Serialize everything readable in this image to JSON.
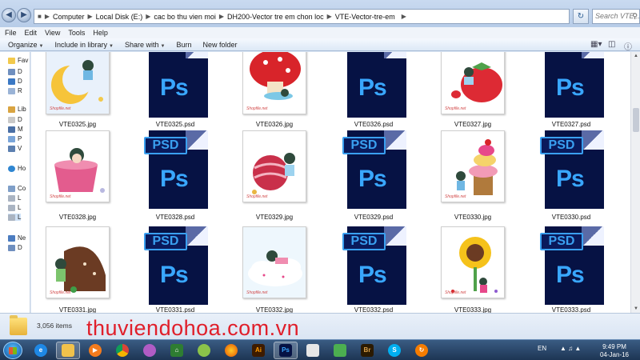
{
  "address": {
    "crumbs": [
      "Computer",
      "Local Disk (E:)",
      "cac bo thu vien moi",
      "DH200-Vector tre em chon loc",
      "VTE-Vector-tre-em"
    ],
    "search_placeholder": "Search VTE..."
  },
  "menu": [
    "File",
    "Edit",
    "View",
    "Tools",
    "Help"
  ],
  "toolbar": {
    "organize": "Organize",
    "include": "Include in library",
    "share": "Share with",
    "burn": "Burn",
    "new_folder": "New folder"
  },
  "navpane": {
    "items": [
      "Fav",
      "D",
      "D",
      "R",
      "Lib",
      "D",
      "M",
      "P",
      "V",
      "Ho",
      "Co",
      "L",
      "L",
      "L",
      "Ne",
      "D"
    ]
  },
  "files": {
    "row1": [
      "VTE0325.jpg",
      "VTE0325.psd",
      "VTE0326.jpg",
      "VTE0326.psd",
      "VTE0327.jpg",
      "VTE0327.psd"
    ],
    "row2": [
      "VTE0328.jpg",
      "VTE0328.psd",
      "VTE0329.jpg",
      "VTE0329.psd",
      "VTE0330.jpg",
      "VTE0330.psd"
    ],
    "row3": [
      "VTE0331.jpg",
      "VTE0331.psd",
      "VTE0332.jpg",
      "VTE0332.psd",
      "VTE0333.jpg",
      "VTE0333.psd"
    ],
    "thumb_watermark": "Shopfile.net",
    "psd_tag": "PSD",
    "psd_mark": "Ps"
  },
  "details": {
    "count": "3,056 items"
  },
  "watermark": "thuviendohoa.com.vn",
  "taskbar": {
    "apps": [
      "ie-icon",
      "explorer-icon",
      "media-icon",
      "chrome-icon",
      "game-icon",
      "vpn-icon",
      "lime-icon",
      "firefox-icon",
      "illustrator-icon",
      "photoshop-icon",
      "notepad-icon",
      "bridge-icon",
      "skype-icon",
      "update-icon"
    ],
    "ai": "Ai",
    "ps": "Ps",
    "br": "Br",
    "language": "EN",
    "time": "9:49 PM",
    "date": "04-Jan-16"
  },
  "colors": {
    "psd_dark": "#061244",
    "psd_blue": "#39a7ff",
    "watermark": "#e01f2a"
  }
}
